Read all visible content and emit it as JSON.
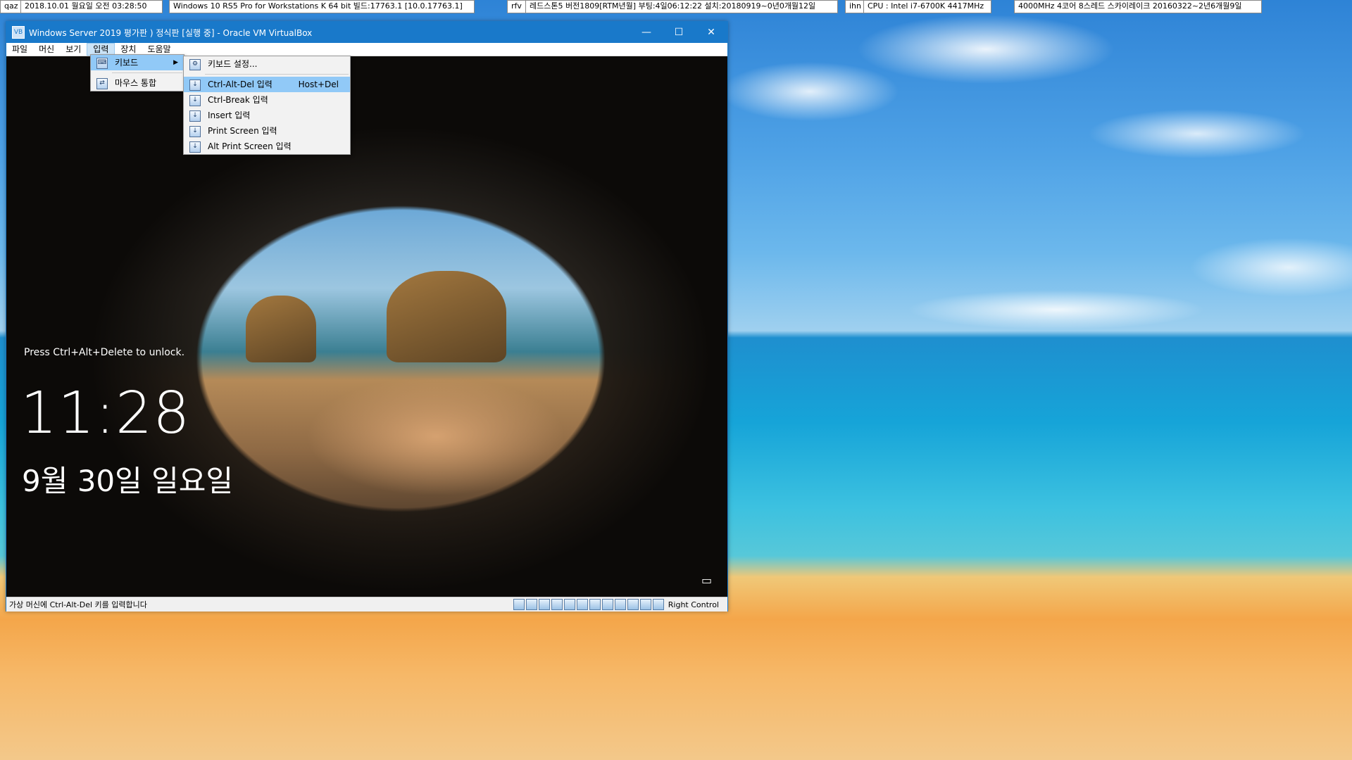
{
  "topbar": {
    "date_key": "qaz",
    "datetime": "2018.10.01 월요일 오전 03:28:50",
    "os_info": "Windows 10 RS5 Pro for Workstations K 64 bit 빌드:17763.1 [10.0.17763.1]",
    "rfv_key": "rfv",
    "build_info": "레드스톤5 버전1809[RTM년월] 부팅:4일06:12:22 설치:20180919~0년0개월12일",
    "ihn_key": "ihn",
    "cpu_info": "CPU : Intel i7-6700K 4417MHz",
    "cpu_detail": "4000MHz 4코어 8스레드 스카이레이크 20160322~2년6개월9일"
  },
  "window": {
    "title": "Windows Server 2019 평가판 ) 정식판 [실행 중] - Oracle VM VirtualBox",
    "minimize": "—",
    "maximize": "☐",
    "close": "✕"
  },
  "menubar": [
    "파일",
    "머신",
    "보기",
    "입력",
    "장치",
    "도움말"
  ],
  "input_menu": {
    "keyboard": "키보드",
    "mouse_integration": "마우스 통합"
  },
  "keyboard_submenu": {
    "settings": "키보드 설정...",
    "items": [
      {
        "label": "Ctrl-Alt-Del 입력",
        "shortcut": "Host+Del"
      },
      {
        "label": "Ctrl-Break 입력",
        "shortcut": ""
      },
      {
        "label": "Insert 입력",
        "shortcut": ""
      },
      {
        "label": "Print Screen 입력",
        "shortcut": ""
      },
      {
        "label": "Alt Print Screen 입력",
        "shortcut": ""
      }
    ]
  },
  "lockscreen": {
    "prompt": "Press Ctrl+Alt+Delete to unlock.",
    "time": "11:28",
    "date": "9월 30일 일요일"
  },
  "statusbar": {
    "message": "가상 머신에 Ctrl-Alt-Del 키를 입력합니다",
    "host_key": "Right Control"
  }
}
